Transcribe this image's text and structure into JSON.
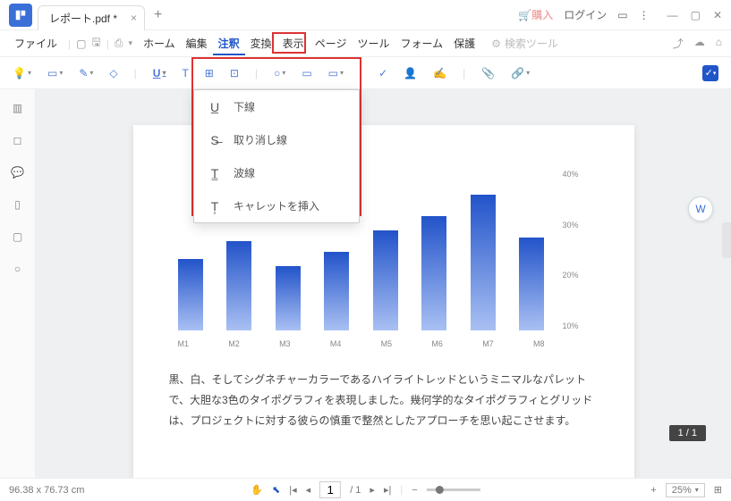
{
  "titlebar": {
    "tab_title": "レポート.pdf *",
    "purchase": "購入",
    "login": "ログイン"
  },
  "menu": {
    "file": "ファイル",
    "items": [
      "ホーム",
      "編集",
      "注釈",
      "変換",
      "表示",
      "ページ",
      "ツール",
      "フォーム",
      "保護"
    ],
    "active_index": 2,
    "search_placeholder": "検索ツール"
  },
  "dropdown": {
    "items": [
      {
        "icon": "U̲",
        "label": "下線"
      },
      {
        "icon": "S̶",
        "label": "取り消し線"
      },
      {
        "icon": "T͇",
        "label": "波線"
      },
      {
        "icon": "T͕",
        "label": "キャレットを挿入"
      }
    ]
  },
  "chart_data": {
    "type": "bar",
    "categories": [
      "M1",
      "M2",
      "M3",
      "M4",
      "M5",
      "M6",
      "M7",
      "M8"
    ],
    "values": [
      20,
      25,
      18,
      22,
      28,
      32,
      38,
      26
    ],
    "ylabels": [
      "40%",
      "30%",
      "20%",
      "10%"
    ],
    "ylim": [
      0,
      40
    ],
    "title": "",
    "xlabel": "",
    "ylabel": ""
  },
  "body_text": "黒、白、そしてシグネチャーカラーであるハイライトレッドというミニマルなパレットで、大胆な3色のタイポグラフィを表現しました。幾何学的なタイポグラフィとグリッドは、プロジェクトに対する彼らの慎重で整然としたアプローチを思い起こさせます。",
  "page_indicator": "1 / 1",
  "status": {
    "dimensions": "96.38 x 76.73 cm",
    "page_current": "1",
    "page_total": "/ 1",
    "zoom": "25%"
  }
}
